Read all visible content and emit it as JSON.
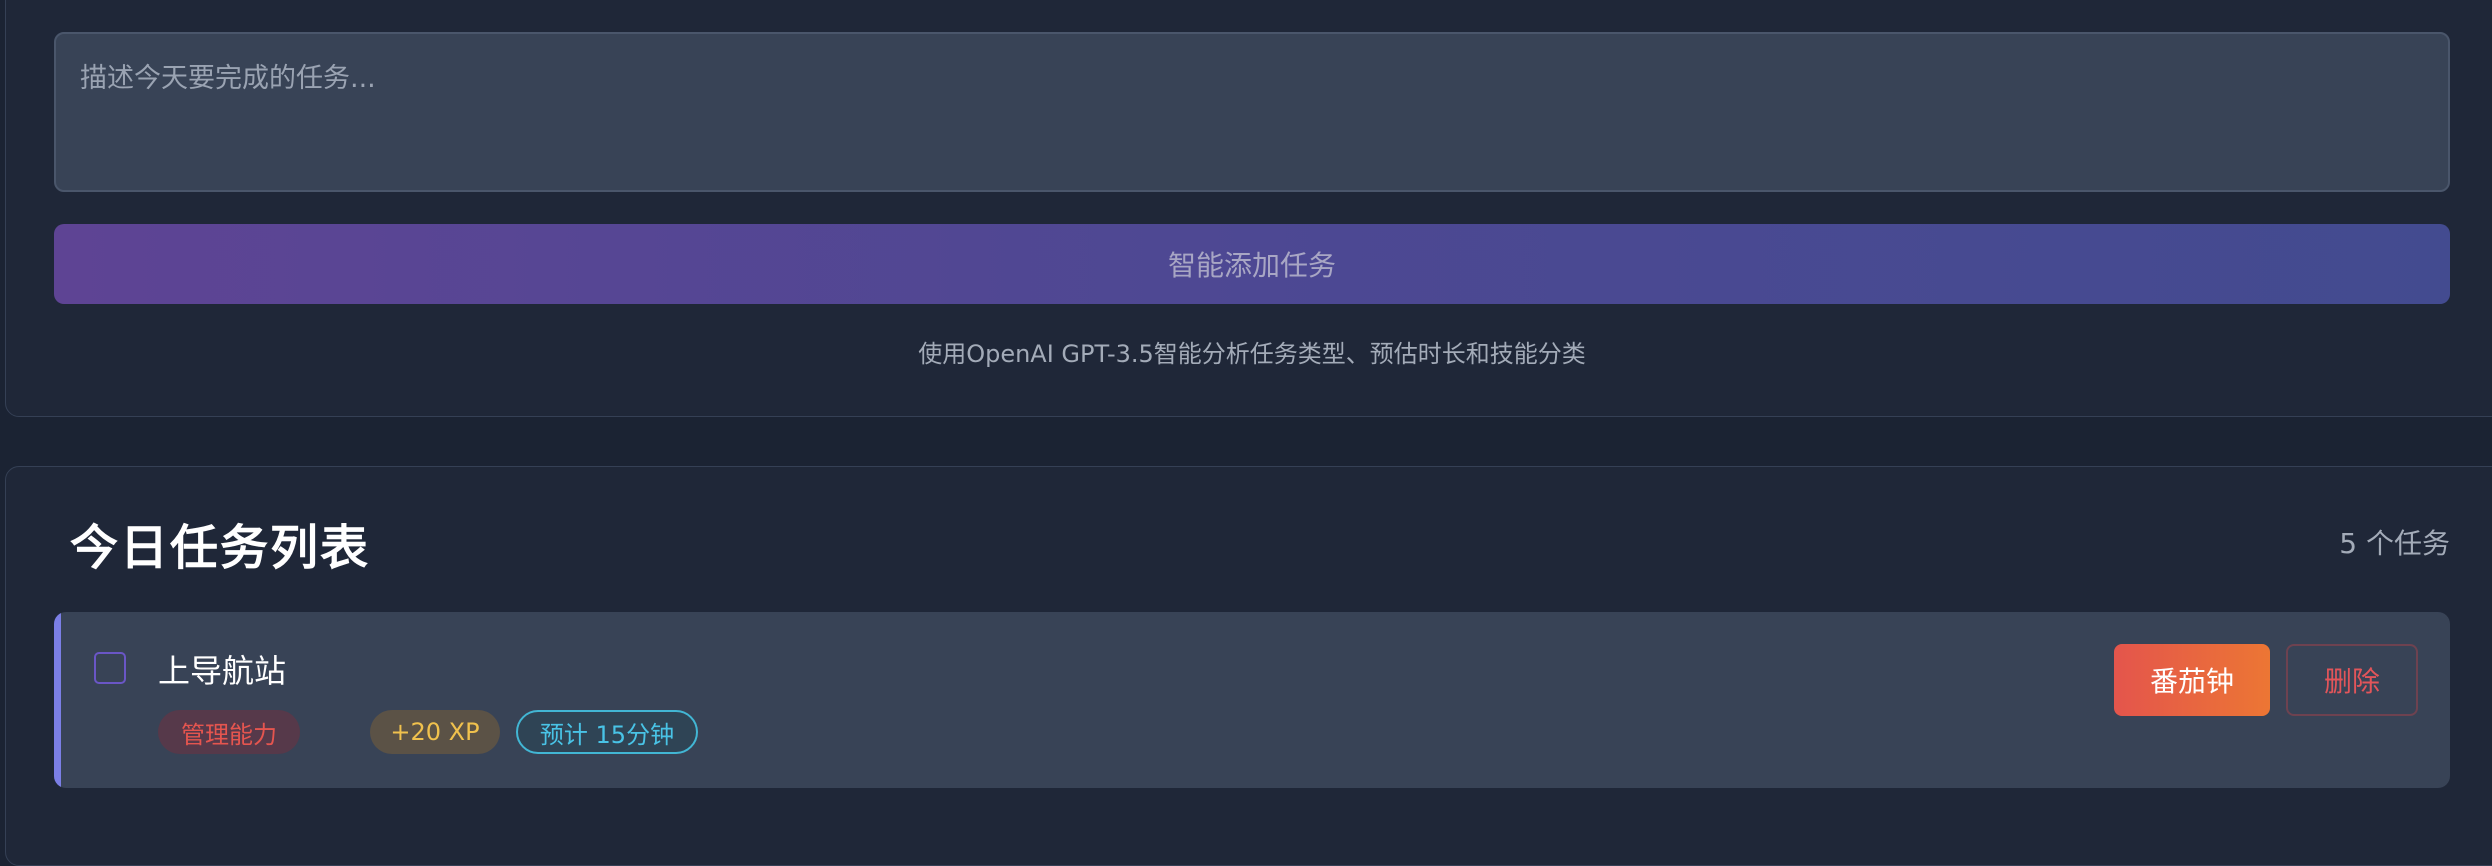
{
  "task_input": {
    "placeholder": "描述今天要完成的任务..."
  },
  "smart_add": {
    "label": "智能添加任务",
    "hint": "使用OpenAI GPT-3.5智能分析任务类型、预估时长和技能分类"
  },
  "task_list": {
    "title": "今日任务列表",
    "count_label": "5 个任务",
    "tasks": [
      {
        "name": "上导航站",
        "skill": "管理能力",
        "xp": "+20 XP",
        "estimate": "预计 15分钟",
        "pomodoro_label": "番茄钟",
        "delete_label": "删除",
        "completed": false
      }
    ]
  },
  "colors": {
    "accent_purple": "#5e4494",
    "accent_indigo": "#434b90",
    "skill_red": "#e5554f",
    "xp_gold": "#f0c14d",
    "time_cyan": "#49c3e6",
    "pomodoro_orange": "#ec7634"
  }
}
